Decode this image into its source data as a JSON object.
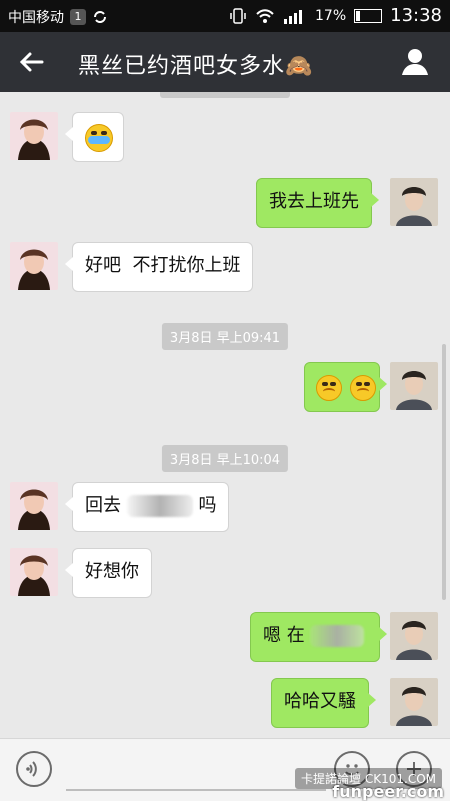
{
  "status": {
    "carrier": "中国移动",
    "sim_badge": "1",
    "battery": "17%",
    "time": "13:38"
  },
  "header": {
    "title": "黑丝已约酒吧女多水🙈"
  },
  "chat": {
    "timestamps": [
      "3月8日 早上09:41",
      "3月8日 早上10:04"
    ],
    "messages": [
      {
        "side": "in",
        "kind": "emoji"
      },
      {
        "side": "out",
        "text": "我去上班先"
      },
      {
        "side": "in",
        "text": "好吧  不打扰你上班"
      },
      {
        "side": "out",
        "kind": "emoji"
      },
      {
        "side": "in",
        "text_prefix": "回去",
        "text_suffix": "吗"
      },
      {
        "side": "in",
        "text": "好想你"
      },
      {
        "side": "out",
        "text_prefix": "嗯 在"
      },
      {
        "side": "out",
        "text": "哈哈又騷"
      }
    ]
  },
  "watermark": {
    "line1": "卡提諾論壇 CK101.COM",
    "line2": "funpeer.com"
  }
}
